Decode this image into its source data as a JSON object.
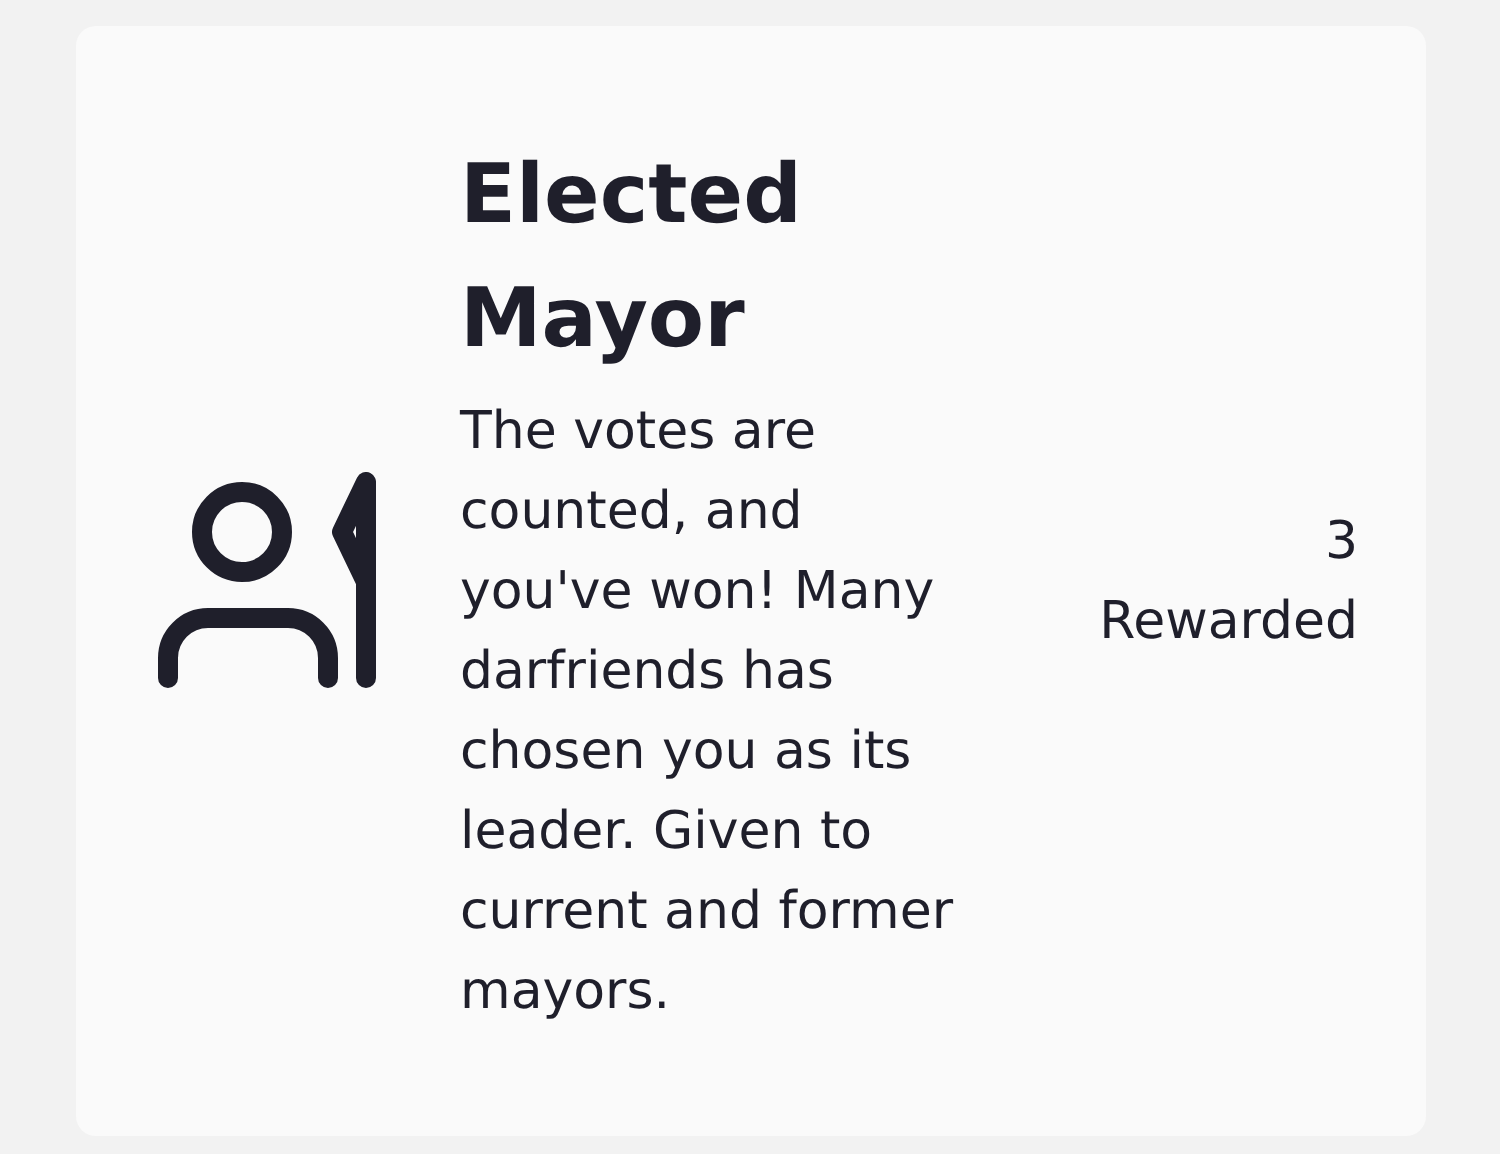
{
  "achievement": {
    "title": "Elected Mayor",
    "description": "The votes are counted, and you've won! Many darfriends has chosen you as its leader. Given to current and former mayors.",
    "count": "3",
    "count_label": "Rewarded"
  }
}
